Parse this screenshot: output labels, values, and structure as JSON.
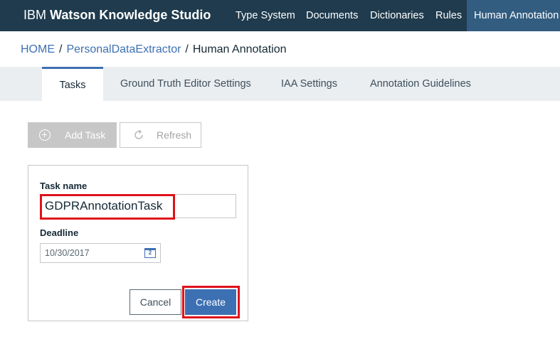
{
  "header": {
    "brand_prefix": "IBM",
    "brand_name": "Watson Knowledge Studio",
    "nav": [
      "Type System",
      "Documents",
      "Dictionaries",
      "Rules",
      "Human Annotation"
    ],
    "active_nav": "Human Annotation"
  },
  "breadcrumb": {
    "home": "HOME",
    "separator": "/",
    "project": "PersonalDataExtractor",
    "current": "Human Annotation"
  },
  "tabs": [
    "Tasks",
    "Ground Truth Editor Settings",
    "IAA Settings",
    "Annotation Guidelines"
  ],
  "active_tab": "Tasks",
  "toolbar": {
    "add_label": "Add Task",
    "refresh_label": "Refresh"
  },
  "form": {
    "task_name_label": "Task name",
    "task_name_value": "GDPRAnnotationTask",
    "deadline_label": "Deadline",
    "deadline_value": "10/30/2017",
    "calendar_day": "2",
    "cancel_label": "Cancel",
    "create_label": "Create"
  },
  "colors": {
    "header_bg": "#1f3b4d",
    "active_nav_bg": "#325c80",
    "link": "#3d70b2",
    "primary_button": "#3d70b2",
    "highlight_box": "#e0121b",
    "disabled_button": "#c7c7c7"
  },
  "icons": {
    "add": "plus-circle-icon",
    "refresh": "refresh-icon",
    "calendar": "calendar-icon"
  }
}
